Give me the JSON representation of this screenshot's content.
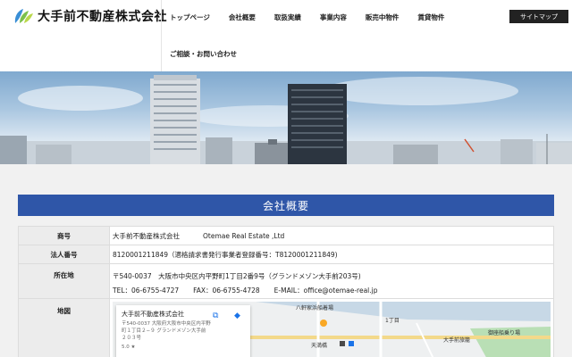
{
  "header": {
    "logo_text": "大手前不動産株式会社",
    "nav_items": [
      "トップページ",
      "会社概要",
      "取扱実績",
      "事業内容",
      "販売中物件",
      "賃貸物件"
    ],
    "nav_contact": "ご相談・お問い合わせ",
    "sitemap_label": "サイトマップ"
  },
  "section": {
    "title": "会社概要"
  },
  "company": {
    "trade_name_label": "商号",
    "trade_name_ja": "大手前不動産株式会社",
    "trade_name_en": "Otemae Real Estate ,Ltd",
    "corp_number_label": "法人番号",
    "corp_number_value": "8120001211849（適格請求書発行事業者登録番号：T8120001211849)",
    "address_label": "所在地",
    "address_value": "〒540-0037　大阪市中央区内平野町1丁目2番9号（グランドメゾン大手前203号)",
    "tel": "TEL：06-6755-4727",
    "fax": "FAX：06-6755-4728",
    "email": "E-MAIL：office@otemae-real.jp",
    "map_label": "地図"
  },
  "map": {
    "card_title": "大手前不動産株式会社",
    "card_address": "〒540-0037 大阪府大阪市中央区内平野町１丁目２−９ グランドメゾン大手前 ２０３号",
    "card_rating": "5.0 ★",
    "labels": [
      "八軒家浜船着場",
      "1丁目",
      "天満橋",
      "大手前旅籠",
      "御座船乗り場"
    ]
  },
  "colors": {
    "accent": "#2f56a8",
    "logo_green": "#7cc04b",
    "logo_blue": "#3a8fd6"
  }
}
